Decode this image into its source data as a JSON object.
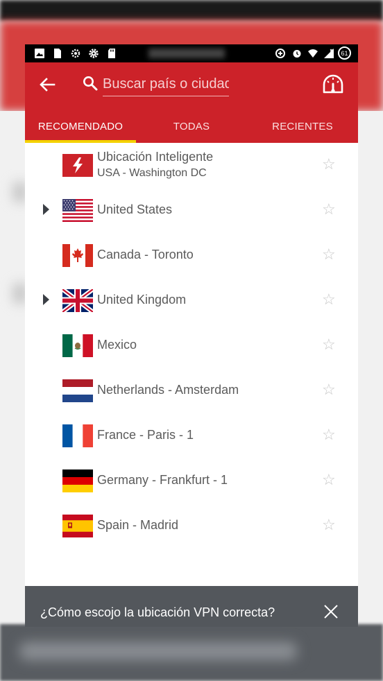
{
  "search": {
    "placeholder": "Buscar país o ciudad"
  },
  "tabs": [
    {
      "label": "RECOMENDADO",
      "active": true
    },
    {
      "label": "TODAS",
      "active": false
    },
    {
      "label": "RECIENTES",
      "active": false
    }
  ],
  "locations": [
    {
      "name": "Ubicación Inteligente",
      "subtitle": "USA - Washington DC",
      "flag": "smart-location-icon",
      "expandable": false,
      "favorite": false
    },
    {
      "name": "United States",
      "flag": "us-flag",
      "expandable": true,
      "favorite": false
    },
    {
      "name": "Canada - Toronto",
      "flag": "canada-flag",
      "expandable": false,
      "favorite": false
    },
    {
      "name": "United Kingdom",
      "flag": "uk-flag",
      "expandable": true,
      "favorite": false
    },
    {
      "name": "Mexico",
      "flag": "mexico-flag",
      "expandable": false,
      "favorite": false
    },
    {
      "name": "Netherlands - Amsterdam",
      "flag": "netherlands-flag",
      "expandable": false,
      "favorite": false
    },
    {
      "name": "France - Paris - 1",
      "flag": "france-flag",
      "expandable": false,
      "favorite": false
    },
    {
      "name": "Germany - Frankfurt - 1",
      "flag": "germany-flag",
      "expandable": false,
      "favorite": false
    },
    {
      "name": "Spain - Madrid",
      "flag": "spain-flag",
      "expandable": false,
      "favorite": false
    }
  ],
  "status_bar": {
    "battery": "61"
  },
  "snackbar": {
    "text": "¿Cómo escojo la ubicación VPN correcta?"
  },
  "colors": {
    "primary": "#cc2229",
    "tab_indicator": "#f4d100",
    "snackbar": "#53575c"
  }
}
